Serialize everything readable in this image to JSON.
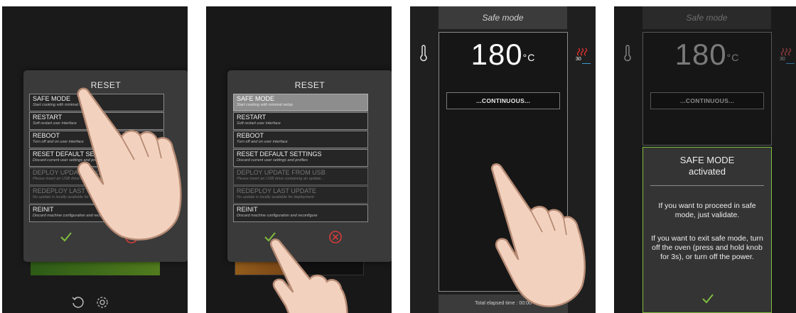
{
  "reset_dialog": {
    "title": "RESET",
    "items": [
      {
        "title": "SAFE MODE",
        "subtitle": "Start cooking with minimal setup",
        "state": "enabled"
      },
      {
        "title": "RESTART",
        "subtitle": "Soft restart user interface",
        "state": "enabled"
      },
      {
        "title": "REBOOT",
        "subtitle": "Turn off and on user interface",
        "state": "enabled"
      },
      {
        "title": "RESET DEFAULT SETTINGS",
        "subtitle": "Discard current user settings and profiles",
        "state": "enabled"
      },
      {
        "title": "DEPLOY UPDATE FROM USB",
        "subtitle": "Please insert an USB drive containing an update...",
        "state": "disabled"
      },
      {
        "title": "REDEPLOY LAST UPDATE",
        "subtitle": "No update is locally available for deployment",
        "state": "disabled"
      },
      {
        "title": "REINIT",
        "subtitle": "Discard machine configuration and reconfigure",
        "state": "enabled"
      }
    ],
    "ok_icon": "check-icon",
    "cancel_icon": "cancel-circle-icon"
  },
  "screen2": {
    "selected_index": 0,
    "progress": 0.4
  },
  "cooking": {
    "mode_title": "Safe mode",
    "temperature": "180",
    "unit": "°C",
    "mode_label": "...CONTINUOUS...",
    "heat_value": "30",
    "elapsed": "Total elapsed time : 00:00"
  },
  "safe_mode_dialog": {
    "title_line1": "SAFE MODE",
    "title_line2": "activated",
    "message1": "If you want to proceed in safe mode, just validate.",
    "message2": "If you want to exit safe mode, turn off the oven (press and hold knob for 3s), or turn off the power."
  },
  "colors": {
    "accent_green": "#7fbd3e",
    "cancel_red": "#d63a3a",
    "heat_red": "#d62f2f",
    "line_blue": "#3a9bd5"
  }
}
